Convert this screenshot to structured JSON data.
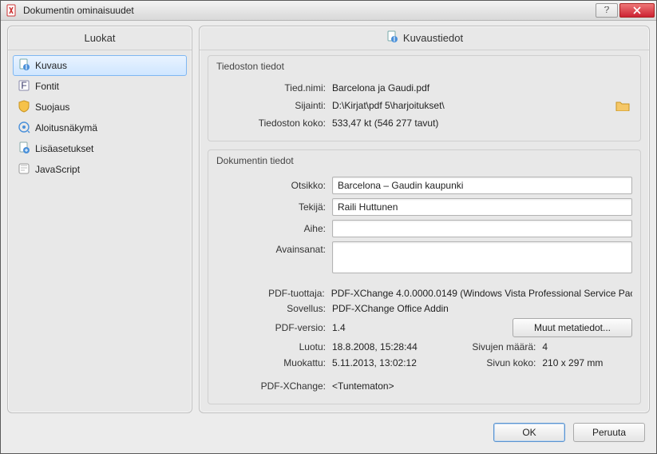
{
  "window": {
    "title": "Dokumentin ominaisuudet"
  },
  "titlebar": {
    "help_tip": "?",
    "close_tip": "Close"
  },
  "panes": {
    "left_header": "Luokat",
    "right_header": "Kuvaustiedot"
  },
  "categories": [
    {
      "label": "Kuvaus",
      "icon": "page-info-icon",
      "selected": true
    },
    {
      "label": "Fontit",
      "icon": "font-icon"
    },
    {
      "label": "Suojaus",
      "icon": "shield-icon"
    },
    {
      "label": "Aloitusnäkymä",
      "icon": "view-icon"
    },
    {
      "label": "Lisäasetukset",
      "icon": "settings-icon"
    },
    {
      "label": "JavaScript",
      "icon": "script-icon"
    }
  ],
  "file_group": {
    "title": "Tiedoston tiedot",
    "rows": {
      "name_lbl": "Tied.nimi:",
      "name_val": "Barcelona ja Gaudi.pdf",
      "loc_lbl": "Sijainti:",
      "loc_val": "D:\\Kirjat\\pdf 5\\harjoitukset\\",
      "size_lbl": "Tiedoston koko:",
      "size_val": "533,47 kt (546 277 tavut)"
    }
  },
  "doc_group": {
    "title": "Dokumentin tiedot",
    "fields": {
      "title_lbl": "Otsikko:",
      "title_val": "Barcelona – Gaudin kaupunki",
      "author_lbl": "Tekijä:",
      "author_val": "Raili Huttunen",
      "subject_lbl": "Aihe:",
      "subject_val": "",
      "keywords_lbl": "Avainsanat:",
      "keywords_val": ""
    },
    "meta": {
      "producer_lbl": "PDF-tuottaja:",
      "producer_val": "PDF-XChange 4.0.0000.0149 (Windows Vista Professional Service Pac",
      "app_lbl": "Sovellus:",
      "app_val": "PDF-XChange Office Addin",
      "ver_lbl": "PDF-versio:",
      "ver_val": "1.4",
      "created_lbl": "Luotu:",
      "created_val": "18.8.2008, 15:28:44",
      "modified_lbl": "Muokattu:",
      "modified_val": "5.11.2013, 13:02:12",
      "pages_lbl": "Sivujen määrä:",
      "pages_val": "4",
      "pagesize_lbl": "Sivun koko:",
      "pagesize_val": "210 x 297 mm",
      "pdfx_lbl": "PDF-XChange:",
      "pdfx_val": "<Tuntematon>",
      "more_btn": "Muut metatiedot..."
    }
  },
  "buttons": {
    "ok": "OK",
    "cancel": "Peruuta"
  }
}
